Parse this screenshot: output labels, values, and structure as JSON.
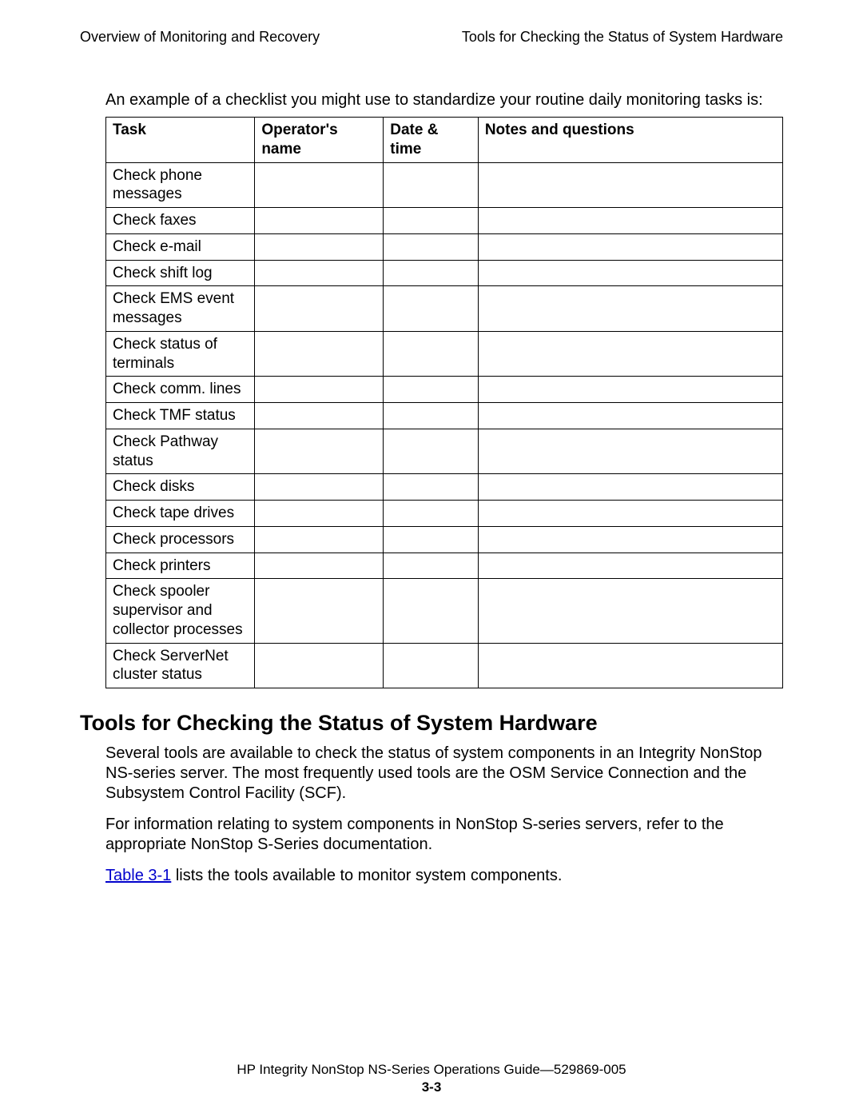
{
  "header": {
    "left": "Overview of Monitoring and Recovery",
    "right": "Tools for Checking the Status of System Hardware"
  },
  "intro": "An example of a checklist you might use to standardize your routine daily monitoring tasks is:",
  "table": {
    "headers": {
      "task": "Task",
      "operator": "Operator's name",
      "datetime": "Date & time",
      "notes": "Notes and questions"
    },
    "rows": [
      {
        "task": "Check phone messages",
        "operator": "",
        "datetime": "",
        "notes": ""
      },
      {
        "task": "Check faxes",
        "operator": "",
        "datetime": "",
        "notes": ""
      },
      {
        "task": "Check e-mail",
        "operator": "",
        "datetime": "",
        "notes": ""
      },
      {
        "task": "Check shift log",
        "operator": "",
        "datetime": "",
        "notes": ""
      },
      {
        "task": "Check EMS event messages",
        "operator": "",
        "datetime": "",
        "notes": ""
      },
      {
        "task": "Check status of terminals",
        "operator": "",
        "datetime": "",
        "notes": ""
      },
      {
        "task": "Check comm. lines",
        "operator": "",
        "datetime": "",
        "notes": ""
      },
      {
        "task": "Check TMF status",
        "operator": "",
        "datetime": "",
        "notes": ""
      },
      {
        "task": "Check Pathway status",
        "operator": "",
        "datetime": "",
        "notes": ""
      },
      {
        "task": "Check disks",
        "operator": "",
        "datetime": "",
        "notes": ""
      },
      {
        "task": "Check tape drives",
        "operator": "",
        "datetime": "",
        "notes": ""
      },
      {
        "task": "Check processors",
        "operator": "",
        "datetime": "",
        "notes": ""
      },
      {
        "task": "Check printers",
        "operator": "",
        "datetime": "",
        "notes": ""
      },
      {
        "task": "Check spooler supervisor and collector processes",
        "operator": "",
        "datetime": "",
        "notes": ""
      },
      {
        "task": "Check ServerNet cluster status",
        "operator": "",
        "datetime": "",
        "notes": ""
      }
    ]
  },
  "section": {
    "title": "Tools for Checking the Status of System Hardware",
    "p1": "Several tools are available to check the status of system components in an Integrity NonStop NS-series server. The most frequently used tools are the OSM Service Connection and the Subsystem Control Facility (SCF).",
    "p2": "For information relating to system components in NonStop S-series servers, refer to the appropriate NonStop S-Series documentation.",
    "p3_link": "Table 3-1",
    "p3_rest": " lists the tools available to monitor system components."
  },
  "footer": {
    "line": "HP Integrity NonStop NS-Series Operations Guide—529869-005",
    "page": "3-3"
  }
}
